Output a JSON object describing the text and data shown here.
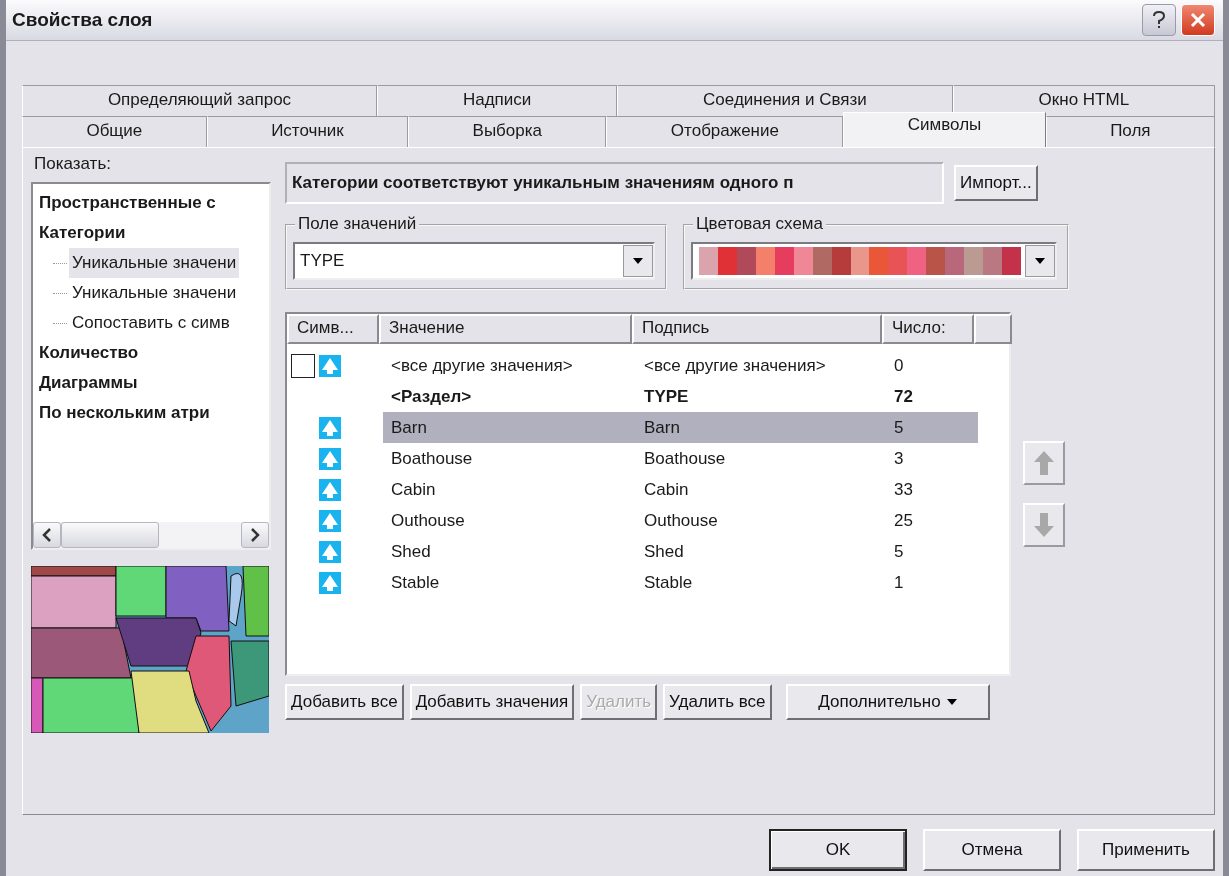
{
  "window": {
    "title": "Свойства слоя"
  },
  "tab_rows": [
    {
      "tabs": [
        {
          "label": "Определяющий запрос",
          "selected": false
        },
        {
          "label": "Надписи",
          "selected": false
        },
        {
          "label": "Соединения и Связи",
          "selected": false
        },
        {
          "label": "Окно HTML",
          "selected": false
        }
      ]
    },
    {
      "tabs": [
        {
          "label": "Общие",
          "selected": false
        },
        {
          "label": "Источник",
          "selected": false
        },
        {
          "label": "Выборка",
          "selected": false
        },
        {
          "label": "Отображение",
          "selected": false
        },
        {
          "label": "Символы",
          "selected": true
        },
        {
          "label": "Поля",
          "selected": false
        }
      ]
    }
  ],
  "show_label": "Показать:",
  "tree": [
    {
      "label": "Пространственные с",
      "selected": false
    },
    {
      "label": "Категории",
      "selected": false,
      "children": [
        {
          "label": "Уникальные значени",
          "selected": true
        },
        {
          "label": "Уникальные значени",
          "selected": false
        },
        {
          "label": "Сопоставить с симв",
          "selected": false
        }
      ]
    },
    {
      "label": "Количество",
      "selected": false
    },
    {
      "label": "Диаграммы",
      "selected": false
    },
    {
      "label": "По нескольким атри",
      "selected": false
    }
  ],
  "description": "Категории соответствуют уникальным значениям одного п",
  "import_button": "Импорт...",
  "value_field": {
    "label": "Поле значений",
    "value": "TYPE"
  },
  "color_scheme": {
    "label": "Цветовая схема",
    "swatches": [
      {
        "color": "#dba3ac"
      },
      {
        "color": "#e03236"
      },
      {
        "color": "#b04a5a"
      },
      {
        "color": "#f47f6a"
      },
      {
        "color": "#e63c5e"
      },
      {
        "color": "#ef8797"
      },
      {
        "color": "#b06a63"
      },
      {
        "color": "#b53c3a"
      },
      {
        "color": "#e8978a"
      },
      {
        "color": "#ea5638"
      },
      {
        "color": "#e85456"
      },
      {
        "color": "#f06282"
      },
      {
        "color": "#b85448"
      },
      {
        "color": "#b8687a"
      },
      {
        "color": "#bb9a92"
      },
      {
        "color": "#b97882"
      },
      {
        "color": "#c33248"
      }
    ]
  },
  "table": {
    "columns": [
      "Симв...",
      "Значение",
      "Подпись",
      "Число:"
    ],
    "rows": [
      {
        "kind": "other",
        "checked": false,
        "value": "<все другие значения>",
        "label": "<все другие значения>",
        "count": "0",
        "selected": false
      },
      {
        "kind": "heading",
        "value": "<Раздел>",
        "label": "TYPE",
        "count": "72",
        "selected": false
      },
      {
        "kind": "value",
        "value": "Barn",
        "label": "Barn",
        "count": "5",
        "selected": true
      },
      {
        "kind": "value",
        "value": "Boathouse",
        "label": "Boathouse",
        "count": "3",
        "selected": false
      },
      {
        "kind": "value",
        "value": "Cabin",
        "label": "Cabin",
        "count": "33",
        "selected": false
      },
      {
        "kind": "value",
        "value": "Outhouse",
        "label": "Outhouse",
        "count": "25",
        "selected": false
      },
      {
        "kind": "value",
        "value": "Shed",
        "label": "Shed",
        "count": "5",
        "selected": false
      },
      {
        "kind": "value",
        "value": "Stable",
        "label": "Stable",
        "count": "1",
        "selected": false
      }
    ]
  },
  "actions": [
    {
      "label": "Добавить все",
      "disabled": false
    },
    {
      "label": "Добавить значения",
      "disabled": false
    },
    {
      "label": "Удалить",
      "disabled": true
    },
    {
      "label": "Удалить все",
      "disabled": false
    }
  ],
  "advanced_button": "Дополнительно",
  "dialog_buttons": [
    {
      "label": "OK",
      "default": true
    },
    {
      "label": "Отмена",
      "default": false
    },
    {
      "label": "Применить",
      "default": false
    }
  ]
}
